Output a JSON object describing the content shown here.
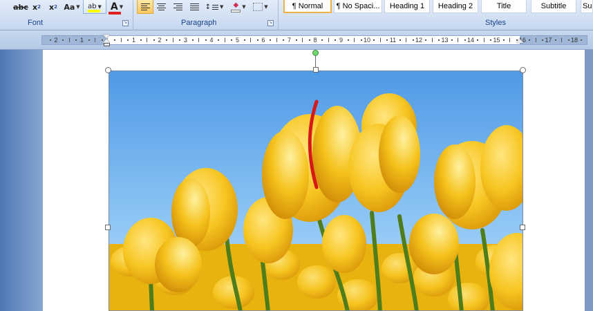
{
  "ribbon": {
    "font_group": {
      "label": "Font",
      "buttons": {
        "strikethrough": "abc",
        "subscript": "x",
        "subscript_mark": "2",
        "superscript": "x",
        "superscript_mark": "2",
        "change_case": "Aa",
        "highlight": "ab",
        "font_color": "A"
      },
      "highlight_color": "#ffff00",
      "font_color_value": "#e02020"
    },
    "paragraph_group": {
      "label": "Paragraph",
      "buttons": [
        "align-left",
        "align-center",
        "align-right",
        "justify",
        "line-spacing",
        "shading",
        "borders"
      ],
      "active": "align-left"
    },
    "styles_group": {
      "label": "Styles",
      "tiles": [
        {
          "label": "¶ Normal",
          "selected": true
        },
        {
          "label": "¶ No Spaci...",
          "selected": false
        },
        {
          "label": "Heading 1",
          "selected": false
        },
        {
          "label": "Heading 2",
          "selected": false
        },
        {
          "label": "Title",
          "selected": false
        },
        {
          "label": "Subtitle",
          "selected": false
        },
        {
          "label": "Sub",
          "selected": false
        }
      ]
    }
  },
  "ruler": {
    "numbers": [
      "2",
      "1",
      "1",
      "2",
      "3",
      "4",
      "5",
      "6",
      "7",
      "8",
      "9",
      "10",
      "11",
      "12",
      "13",
      "14",
      "15",
      "16",
      "17",
      "18"
    ]
  },
  "colors": {
    "ribbon_label": "#15428b",
    "selected_style_border": "#f0b040",
    "workspace": "#86a6d0",
    "page": "#ffffff",
    "rotate_handle": "#6fd86f"
  },
  "document": {
    "picture": {
      "subject": "yellow tulips against blue sky",
      "selected": true
    }
  }
}
